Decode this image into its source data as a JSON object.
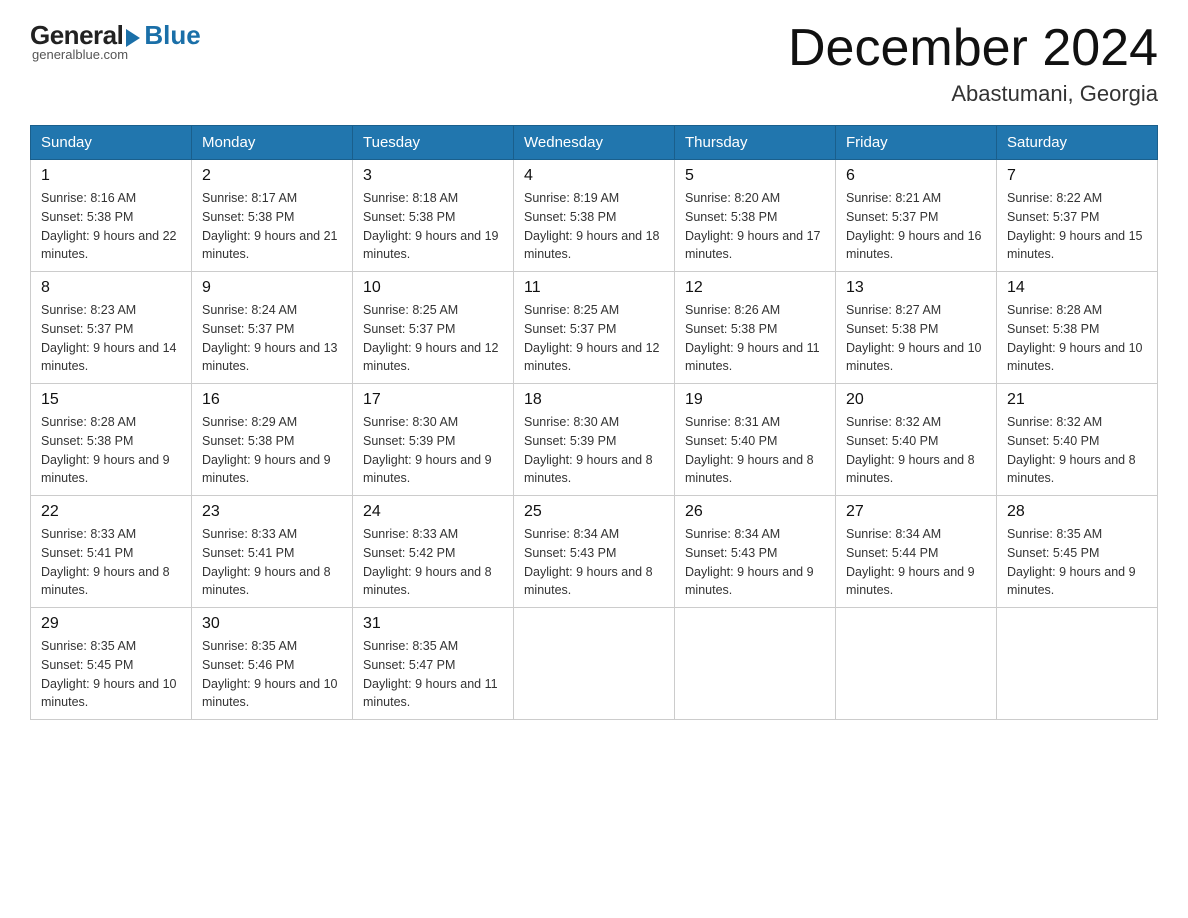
{
  "logo": {
    "general": "General",
    "blue": "Blue",
    "tagline": "generalblue.com"
  },
  "title": "December 2024",
  "location": "Abastumani, Georgia",
  "days_of_week": [
    "Sunday",
    "Monday",
    "Tuesday",
    "Wednesday",
    "Thursday",
    "Friday",
    "Saturday"
  ],
  "weeks": [
    [
      {
        "day": "1",
        "sunrise": "8:16 AM",
        "sunset": "5:38 PM",
        "daylight": "9 hours and 22 minutes."
      },
      {
        "day": "2",
        "sunrise": "8:17 AM",
        "sunset": "5:38 PM",
        "daylight": "9 hours and 21 minutes."
      },
      {
        "day": "3",
        "sunrise": "8:18 AM",
        "sunset": "5:38 PM",
        "daylight": "9 hours and 19 minutes."
      },
      {
        "day": "4",
        "sunrise": "8:19 AM",
        "sunset": "5:38 PM",
        "daylight": "9 hours and 18 minutes."
      },
      {
        "day": "5",
        "sunrise": "8:20 AM",
        "sunset": "5:38 PM",
        "daylight": "9 hours and 17 minutes."
      },
      {
        "day": "6",
        "sunrise": "8:21 AM",
        "sunset": "5:37 PM",
        "daylight": "9 hours and 16 minutes."
      },
      {
        "day": "7",
        "sunrise": "8:22 AM",
        "sunset": "5:37 PM",
        "daylight": "9 hours and 15 minutes."
      }
    ],
    [
      {
        "day": "8",
        "sunrise": "8:23 AM",
        "sunset": "5:37 PM",
        "daylight": "9 hours and 14 minutes."
      },
      {
        "day": "9",
        "sunrise": "8:24 AM",
        "sunset": "5:37 PM",
        "daylight": "9 hours and 13 minutes."
      },
      {
        "day": "10",
        "sunrise": "8:25 AM",
        "sunset": "5:37 PM",
        "daylight": "9 hours and 12 minutes."
      },
      {
        "day": "11",
        "sunrise": "8:25 AM",
        "sunset": "5:37 PM",
        "daylight": "9 hours and 12 minutes."
      },
      {
        "day": "12",
        "sunrise": "8:26 AM",
        "sunset": "5:38 PM",
        "daylight": "9 hours and 11 minutes."
      },
      {
        "day": "13",
        "sunrise": "8:27 AM",
        "sunset": "5:38 PM",
        "daylight": "9 hours and 10 minutes."
      },
      {
        "day": "14",
        "sunrise": "8:28 AM",
        "sunset": "5:38 PM",
        "daylight": "9 hours and 10 minutes."
      }
    ],
    [
      {
        "day": "15",
        "sunrise": "8:28 AM",
        "sunset": "5:38 PM",
        "daylight": "9 hours and 9 minutes."
      },
      {
        "day": "16",
        "sunrise": "8:29 AM",
        "sunset": "5:38 PM",
        "daylight": "9 hours and 9 minutes."
      },
      {
        "day": "17",
        "sunrise": "8:30 AM",
        "sunset": "5:39 PM",
        "daylight": "9 hours and 9 minutes."
      },
      {
        "day": "18",
        "sunrise": "8:30 AM",
        "sunset": "5:39 PM",
        "daylight": "9 hours and 8 minutes."
      },
      {
        "day": "19",
        "sunrise": "8:31 AM",
        "sunset": "5:40 PM",
        "daylight": "9 hours and 8 minutes."
      },
      {
        "day": "20",
        "sunrise": "8:32 AM",
        "sunset": "5:40 PM",
        "daylight": "9 hours and 8 minutes."
      },
      {
        "day": "21",
        "sunrise": "8:32 AM",
        "sunset": "5:40 PM",
        "daylight": "9 hours and 8 minutes."
      }
    ],
    [
      {
        "day": "22",
        "sunrise": "8:33 AM",
        "sunset": "5:41 PM",
        "daylight": "9 hours and 8 minutes."
      },
      {
        "day": "23",
        "sunrise": "8:33 AM",
        "sunset": "5:41 PM",
        "daylight": "9 hours and 8 minutes."
      },
      {
        "day": "24",
        "sunrise": "8:33 AM",
        "sunset": "5:42 PM",
        "daylight": "9 hours and 8 minutes."
      },
      {
        "day": "25",
        "sunrise": "8:34 AM",
        "sunset": "5:43 PM",
        "daylight": "9 hours and 8 minutes."
      },
      {
        "day": "26",
        "sunrise": "8:34 AM",
        "sunset": "5:43 PM",
        "daylight": "9 hours and 9 minutes."
      },
      {
        "day": "27",
        "sunrise": "8:34 AM",
        "sunset": "5:44 PM",
        "daylight": "9 hours and 9 minutes."
      },
      {
        "day": "28",
        "sunrise": "8:35 AM",
        "sunset": "5:45 PM",
        "daylight": "9 hours and 9 minutes."
      }
    ],
    [
      {
        "day": "29",
        "sunrise": "8:35 AM",
        "sunset": "5:45 PM",
        "daylight": "9 hours and 10 minutes."
      },
      {
        "day": "30",
        "sunrise": "8:35 AM",
        "sunset": "5:46 PM",
        "daylight": "9 hours and 10 minutes."
      },
      {
        "day": "31",
        "sunrise": "8:35 AM",
        "sunset": "5:47 PM",
        "daylight": "9 hours and 11 minutes."
      },
      null,
      null,
      null,
      null
    ]
  ]
}
